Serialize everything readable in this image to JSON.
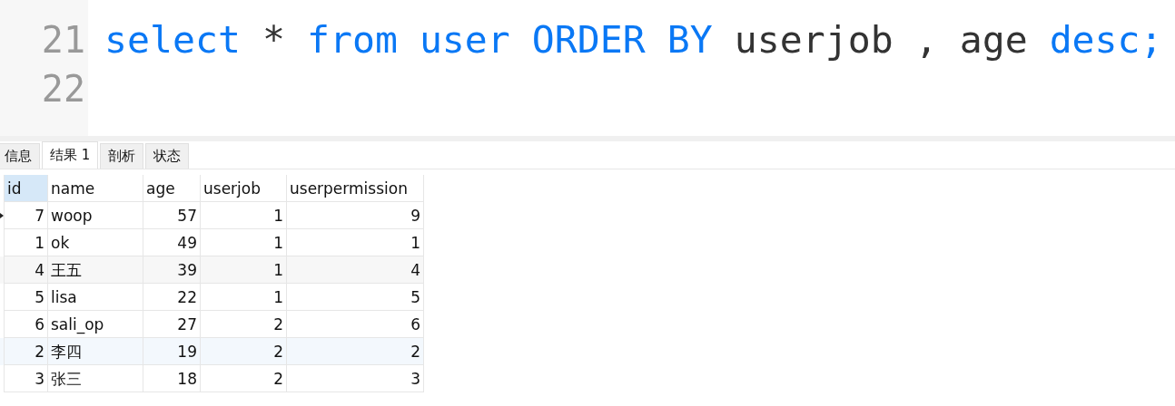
{
  "editor": {
    "lines": [
      {
        "number": "21",
        "tokens": [
          {
            "text": "select",
            "kind": "keyword"
          },
          {
            "text": "*",
            "kind": "plain"
          },
          {
            "text": "from",
            "kind": "keyword"
          },
          {
            "text": "user",
            "kind": "keyword"
          },
          {
            "text": "ORDER",
            "kind": "keyword"
          },
          {
            "text": "BY",
            "kind": "keyword"
          },
          {
            "text": "userjob",
            "kind": "plain"
          },
          {
            "text": ",",
            "kind": "plain"
          },
          {
            "text": "age",
            "kind": "plain"
          },
          {
            "text": "desc;",
            "kind": "keyword"
          }
        ]
      },
      {
        "number": "22"
      }
    ]
  },
  "tabs": [
    {
      "label": "信息",
      "selected": false
    },
    {
      "label": "结果 1",
      "selected": true
    },
    {
      "label": "剖析",
      "selected": false
    },
    {
      "label": "状态",
      "selected": false
    }
  ],
  "table": {
    "columns": [
      {
        "label": "id",
        "kind": "number",
        "selected": true
      },
      {
        "label": "name",
        "kind": "text",
        "selected": false
      },
      {
        "label": "age",
        "kind": "number",
        "selected": false
      },
      {
        "label": "userjob",
        "kind": "number",
        "selected": false
      },
      {
        "label": "userpermission",
        "kind": "number",
        "selected": false
      }
    ],
    "rows": [
      {
        "current": true,
        "shaded": false,
        "hovered": false,
        "cells": [
          "7",
          "woop",
          "57",
          "1",
          "9"
        ]
      },
      {
        "current": false,
        "shaded": false,
        "hovered": false,
        "cells": [
          "1",
          "ok",
          "49",
          "1",
          "1"
        ]
      },
      {
        "current": false,
        "shaded": true,
        "hovered": false,
        "cells": [
          "4",
          "王五",
          "39",
          "1",
          "4"
        ]
      },
      {
        "current": false,
        "shaded": false,
        "hovered": false,
        "cells": [
          "5",
          "lisa",
          "22",
          "1",
          "5"
        ]
      },
      {
        "current": false,
        "shaded": false,
        "hovered": false,
        "cells": [
          "6",
          "sali_op",
          "27",
          "2",
          "6"
        ]
      },
      {
        "current": false,
        "shaded": false,
        "hovered": true,
        "cells": [
          "2",
          "李四",
          "19",
          "2",
          "2"
        ]
      },
      {
        "current": false,
        "shaded": false,
        "hovered": false,
        "cells": [
          "3",
          "张三",
          "18",
          "2",
          "3"
        ]
      }
    ]
  }
}
